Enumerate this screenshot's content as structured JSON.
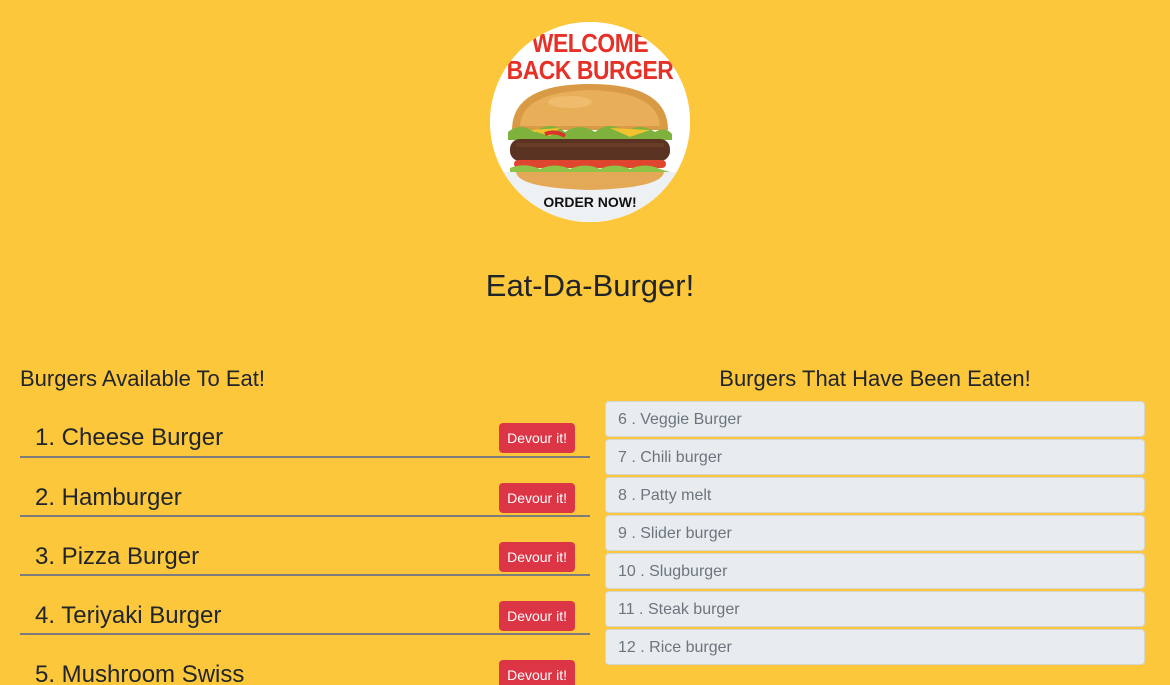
{
  "logo": {
    "text_top": "WELCOME BACK BURGER",
    "text_bottom": "ORDER NOW!"
  },
  "page_title": "Eat-Da-Burger!",
  "available": {
    "heading": "Burgers Available To Eat!",
    "button_label": "Devour it!",
    "items": [
      {
        "label": "1. Cheese Burger"
      },
      {
        "label": "2. Hamburger"
      },
      {
        "label": "3. Pizza Burger"
      },
      {
        "label": "4. Teriyaki Burger"
      },
      {
        "label": "5. Mushroom Swiss"
      }
    ]
  },
  "eaten": {
    "heading": "Burgers That Have Been Eaten!",
    "items": [
      {
        "label": "6 . Veggie Burger"
      },
      {
        "label": "7 . Chili burger"
      },
      {
        "label": "8 . Patty melt"
      },
      {
        "label": "9 . Slider burger"
      },
      {
        "label": "10 . Slugburger"
      },
      {
        "label": "11 . Steak burger"
      },
      {
        "label": "12 . Rice burger"
      }
    ]
  },
  "colors": {
    "background": "#fcc73a",
    "button": "#dc3545",
    "eaten_item_bg": "#e9ecef"
  }
}
